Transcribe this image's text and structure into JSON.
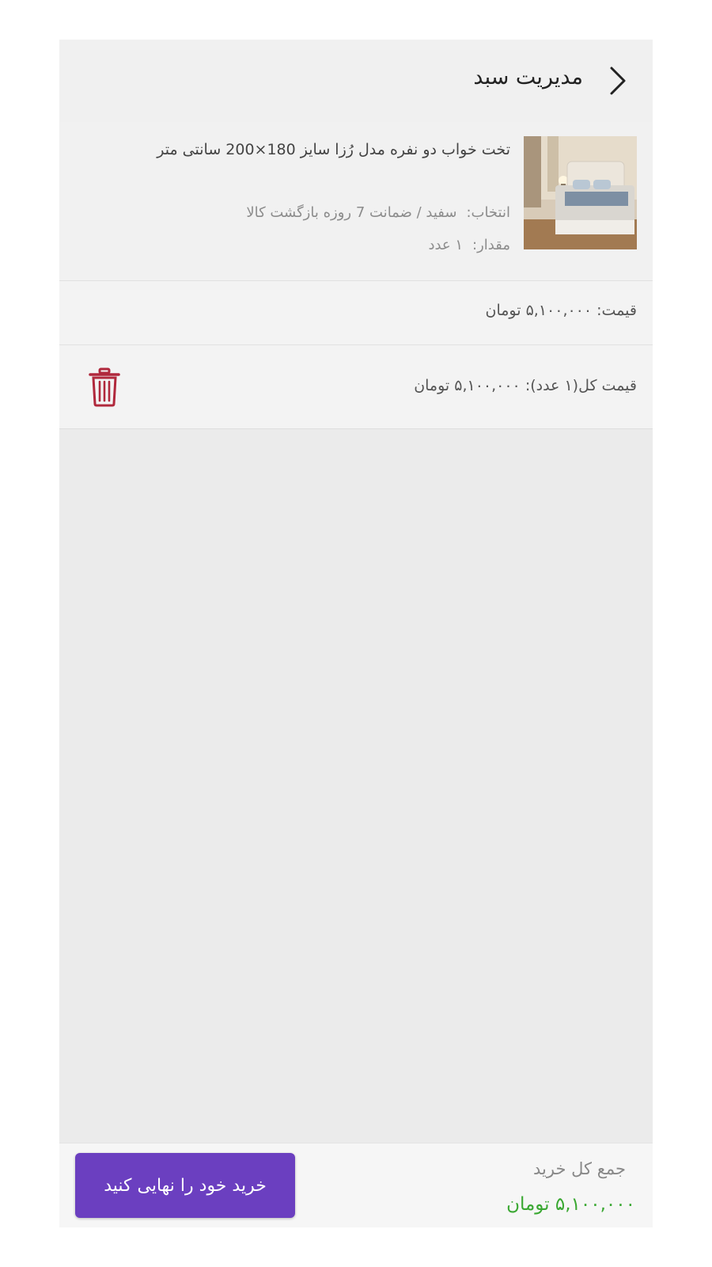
{
  "header": {
    "title": "مدیریت سبد",
    "back_icon": "chevron-right-icon"
  },
  "cart_item": {
    "image": "bed-product-photo",
    "title": "تخت خواب دو نفره مدل رُزا سایز 180×200 سانتی متر",
    "selection_label": "انتخاب:",
    "selection_value": "سفید / ضمانت 7 روزه بازگشت کالا",
    "quantity_label": "مقدار:",
    "quantity_value": "۱ عدد"
  },
  "price_row": {
    "label": "قیمت:",
    "value": "۵,۱۰۰,۰۰۰ تومان"
  },
  "total_row": {
    "label": "قیمت کل(۱ عدد):",
    "value": "۵,۱۰۰,۰۰۰ تومان",
    "delete_icon": "trash-icon"
  },
  "footer": {
    "sum_label": "جمع کل خرید",
    "sum_value": "۵,۱۰۰,۰۰۰ تومان",
    "checkout_label": "خرید خود را نهایی کنید"
  },
  "colors": {
    "accent": "#6b3fc0",
    "price_green": "#3aa832",
    "trash_red": "#b0283c"
  }
}
